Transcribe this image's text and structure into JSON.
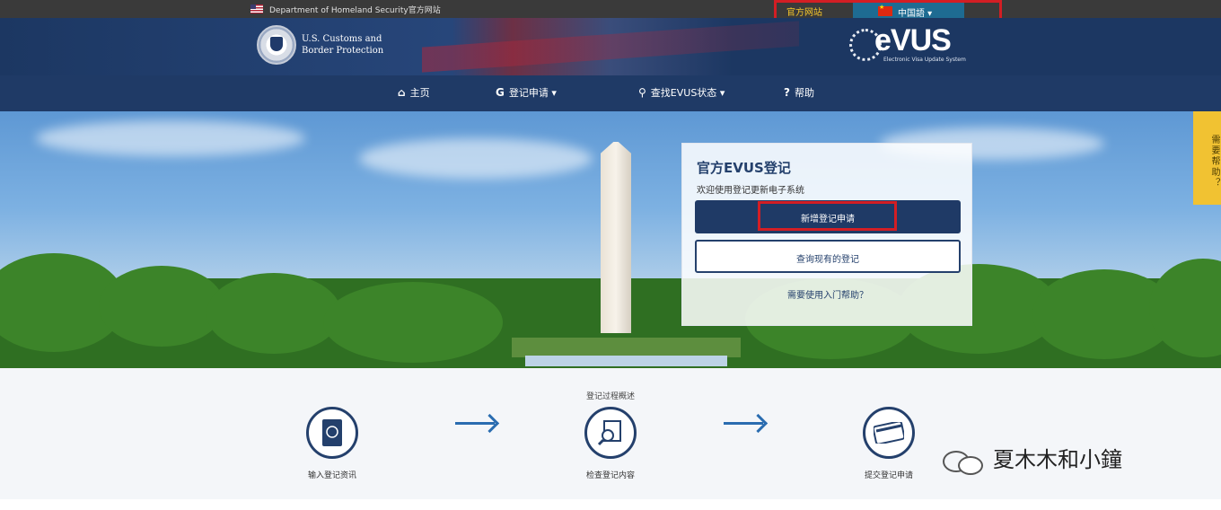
{
  "topbar": {
    "dhs_text": "Department of Homeland Security官方网站",
    "official_text": "官方网站",
    "language": "中国語"
  },
  "header": {
    "agency_line1": "U.S. Customs and",
    "agency_line2": "Border Protection",
    "brand": "eVUS",
    "brand_sub": "Electronic Visa Update System"
  },
  "nav": {
    "home": "主页",
    "enroll": "登记申请",
    "check_status": "查找EVUS状态",
    "help": "帮助"
  },
  "side_tab": "需要帮助？",
  "panel": {
    "title": "官方EVUS登记",
    "welcome": "欢迎使用登记更新电子系统",
    "new_button": "新增登记申请",
    "existing_button": "查询现有的登记",
    "help_link": "需要使用入门帮助？"
  },
  "steps": {
    "heading": "登记过程概述",
    "items": [
      {
        "label": "输入登记资讯"
      },
      {
        "label": "检查登记内容"
      },
      {
        "label": "提交登记申请"
      }
    ]
  },
  "watermark": "夏木木和小鐘",
  "colors": {
    "navy": "#1f3a66",
    "highlight_red": "#d31e24",
    "arrow_blue": "#2a6cb0",
    "help_tab_yellow": "#f1c232"
  }
}
